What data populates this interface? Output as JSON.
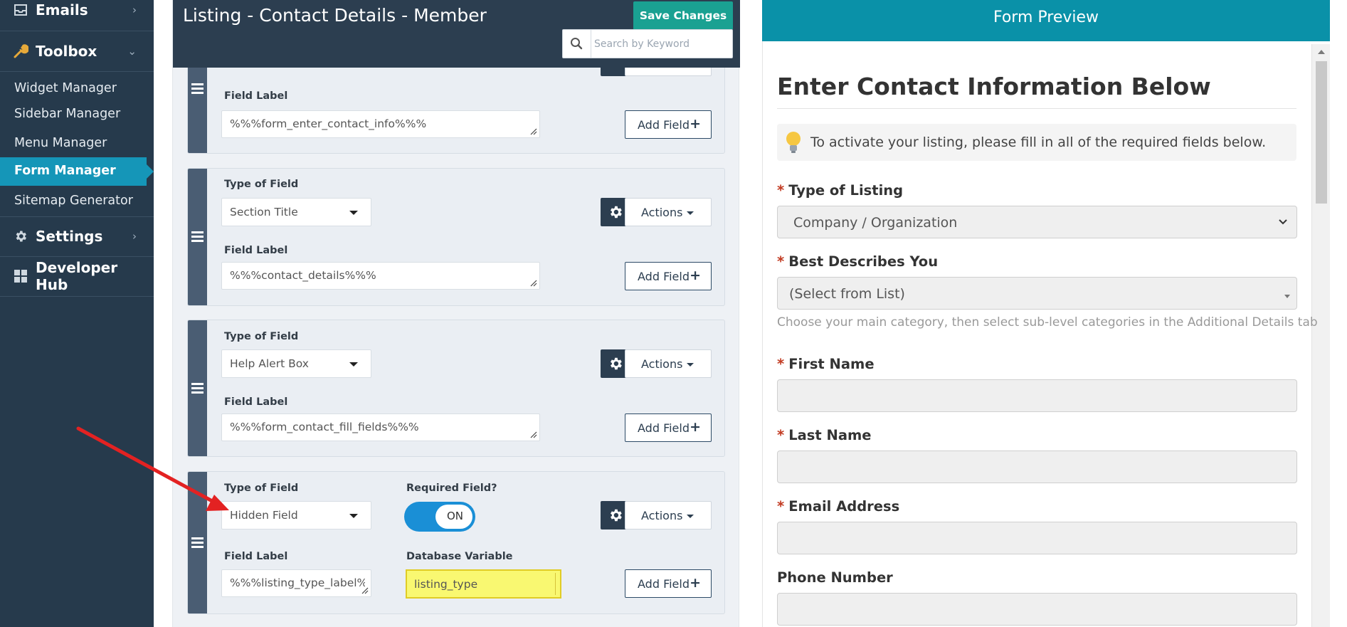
{
  "sidebar": {
    "emails_label": "Emails",
    "toolbox_label": "Toolbox",
    "sub_items": [
      "Widget Manager",
      "Sidebar Manager",
      "Menu Manager",
      "Form Manager",
      "Sitemap Generator"
    ],
    "settings_label": "Settings",
    "devhub_label": "Developer Hub"
  },
  "editor": {
    "title": "Listing - Contact Details - Member",
    "save_label": "Save Changes",
    "search_placeholder": "Search by Keyword",
    "type_label": "Type of Field",
    "field_label_label": "Field Label",
    "required_label": "Required Field?",
    "dbvar_label": "Database Variable",
    "actions_label": "Actions",
    "add_field_label": "Add Field",
    "toggle_label": "ON",
    "cards": [
      {
        "field_label": "%%%form_enter_contact_info%%%"
      },
      {
        "type": "Section Title",
        "field_label": "%%%contact_details%%%"
      },
      {
        "type": "Help Alert Box",
        "field_label": "%%%form_contact_fill_fields%%%"
      },
      {
        "type": "Hidden Field",
        "field_label": "%%%listing_type_label%",
        "db_variable": "listing_type",
        "required": true
      }
    ]
  },
  "preview": {
    "header": "Form Preview",
    "title": "Enter Contact Information Below",
    "alert": "To activate your listing, please fill in all of the required fields below.",
    "listing_type_label": "Type of Listing",
    "listing_type_value": "Company / Organization",
    "describes_label": "Best Describes You",
    "describes_value": "(Select from List)",
    "describes_help": "Choose your main category, then select sub-level categories in the Additional Details tab",
    "first_name_label": "First Name",
    "last_name_label": "Last Name",
    "email_label": "Email Address",
    "phone_label": "Phone Number",
    "required_mark": "*"
  },
  "colors": {
    "sidebar_bg": "#263a4c",
    "active_item": "#1596b8",
    "header_dark": "#2c3e50",
    "save_green": "#1aa192",
    "toggle_blue": "#1a8fd6",
    "highlight_yellow": "#f9f871",
    "annotation_arrow": "#e32222",
    "preview_teal": "#0a91a8"
  }
}
